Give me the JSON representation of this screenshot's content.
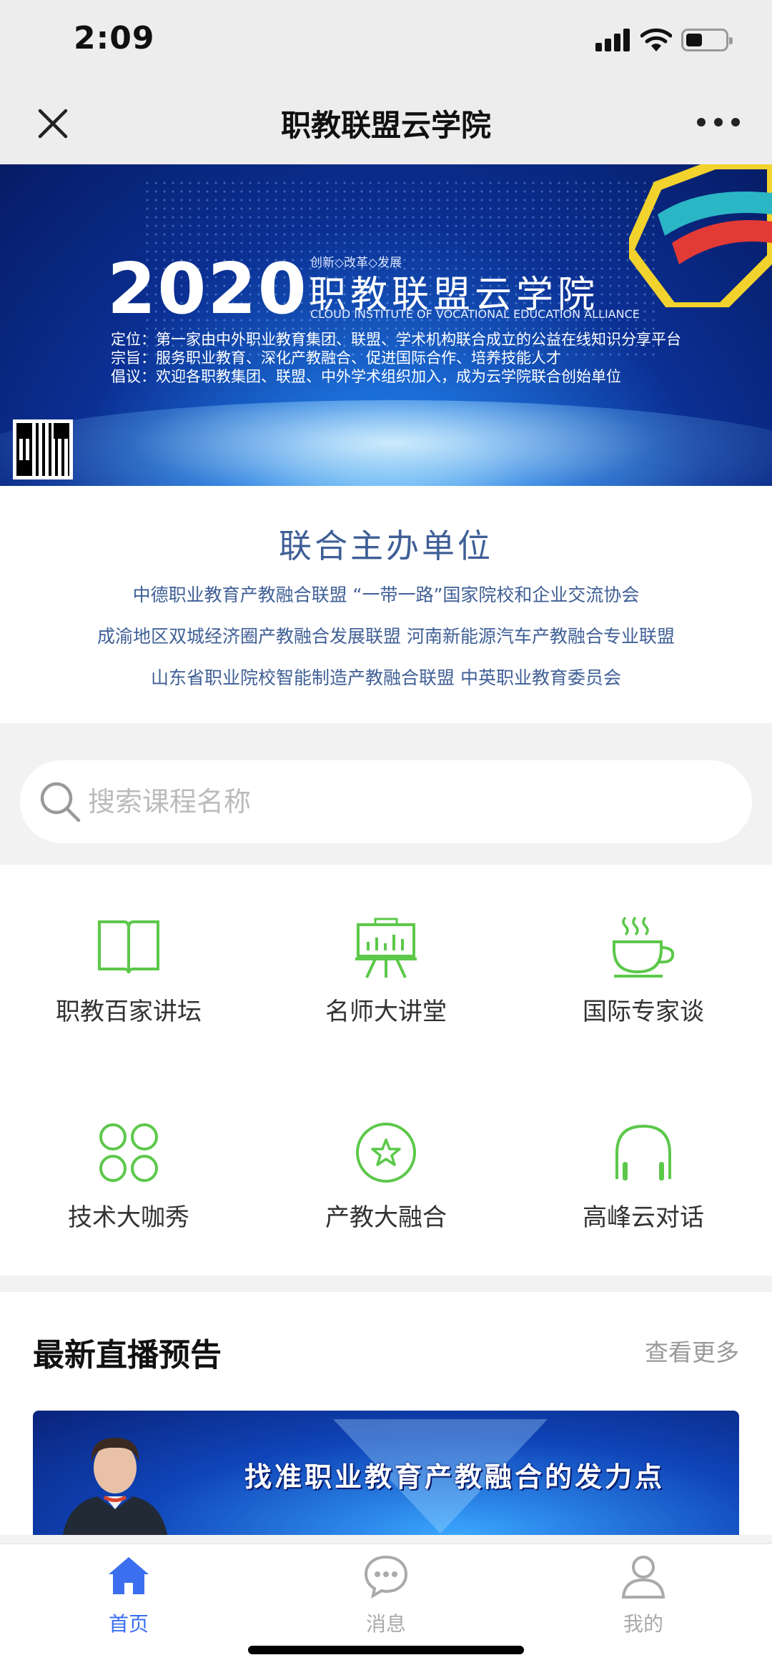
{
  "status_bar": {
    "time": "2:09"
  },
  "nav": {
    "title": "职教联盟云学院"
  },
  "banner": {
    "year": "2020",
    "slogan": "创新◇改革◇发展",
    "title": "职教联盟云学院",
    "english": "CLOUD INSTITUTE OF VOCATIONAL EDUCATION ALLIANCE",
    "lines": [
      "定位：第一家由中外职业教育集团、联盟、学术机构联合成立的公益在线知识分享平台",
      "宗旨：服务职业教育、深化产教融合、促进国际合作、培养技能人才",
      "倡议：欢迎各职教集团、联盟、中外学术组织加入，成为云学院联合创始单位"
    ]
  },
  "organizers": {
    "title": "联合主办单位",
    "lines": [
      "中德职业教育产教融合联盟 “一带一路”国家院校和企业交流协会",
      "成渝地区双城经济圈产教融合发展联盟  河南新能源汽车产教融合专业联盟",
      "山东省职业院校智能制造产教融合联盟  中英职业教育委员会"
    ]
  },
  "search": {
    "placeholder": "搜索课程名称"
  },
  "categories": [
    {
      "label": "职教百家讲坛",
      "icon": "book-icon"
    },
    {
      "label": "名师大讲堂",
      "icon": "presentation-board-icon"
    },
    {
      "label": "国际专家谈",
      "icon": "coffee-cup-icon"
    },
    {
      "label": "技术大咖秀",
      "icon": "clover-icon"
    },
    {
      "label": "产教大融合",
      "icon": "star-circle-icon"
    },
    {
      "label": "高峰云对话",
      "icon": "headphones-icon"
    }
  ],
  "live": {
    "title": "最新直播预告",
    "more": "查看更多",
    "card_title": "找准职业教育产教融合的发力点"
  },
  "tabbar": [
    {
      "label": "首页",
      "icon": "home-icon",
      "active": true
    },
    {
      "label": "消息",
      "icon": "message-icon",
      "active": false
    },
    {
      "label": "我的",
      "icon": "profile-icon",
      "active": false
    }
  ],
  "colors": {
    "accent_green": "#5cc84a",
    "tab_active": "#3b6ff0",
    "tab_inactive": "#aaaaaa",
    "org_blue": "#3f5f96"
  }
}
